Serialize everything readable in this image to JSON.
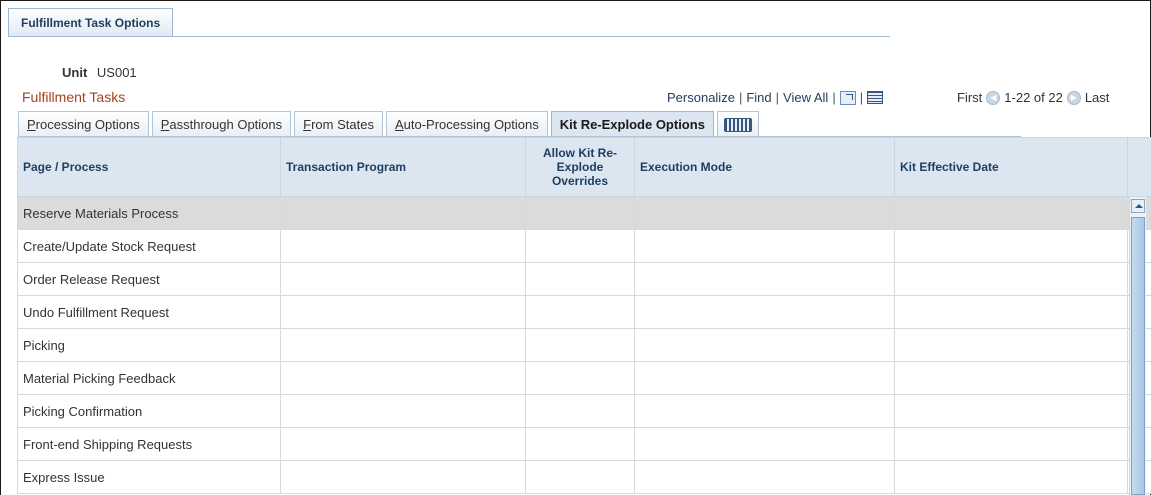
{
  "page": {
    "tab_label": "Fulfillment Task Options",
    "unit_label": "Unit",
    "unit_value": "US001"
  },
  "grid": {
    "title": "Fulfillment Tasks",
    "nav": {
      "personalize": "Personalize",
      "find": "Find",
      "view_all": "View All",
      "sep": "|",
      "zoom_icon": "zoom-icon",
      "download_icon": "download-icon"
    },
    "pager": {
      "first": "First",
      "range": "1-22 of 22",
      "last": "Last",
      "prev_icon": "previous-icon",
      "next_icon": "next-icon"
    },
    "tabs": [
      {
        "pre": "",
        "ul": "P",
        "post": "rocessing Options"
      },
      {
        "pre": "",
        "ul": "P",
        "post": "assthrough Options"
      },
      {
        "pre": "",
        "ul": "F",
        "post": "rom States"
      },
      {
        "pre": "",
        "ul": "A",
        "post": "uto-Processing Options"
      },
      {
        "pre": "Kit Re-Explode Options",
        "ul": "",
        "post": ""
      }
    ],
    "show_all_icon": "show-all-columns-icon",
    "columns": [
      "Page / Process",
      "Transaction Program",
      "Allow Kit Re-Explode Overrides",
      "Execution Mode",
      "Kit Effective Date"
    ],
    "rows": [
      "Reserve Materials Process",
      "Create/Update Stock Request",
      "Order Release Request",
      "Undo Fulfillment Request",
      "Picking",
      "Material Picking Feedback",
      "Picking Confirmation",
      "Front-end Shipping Requests",
      "Express Issue"
    ]
  }
}
